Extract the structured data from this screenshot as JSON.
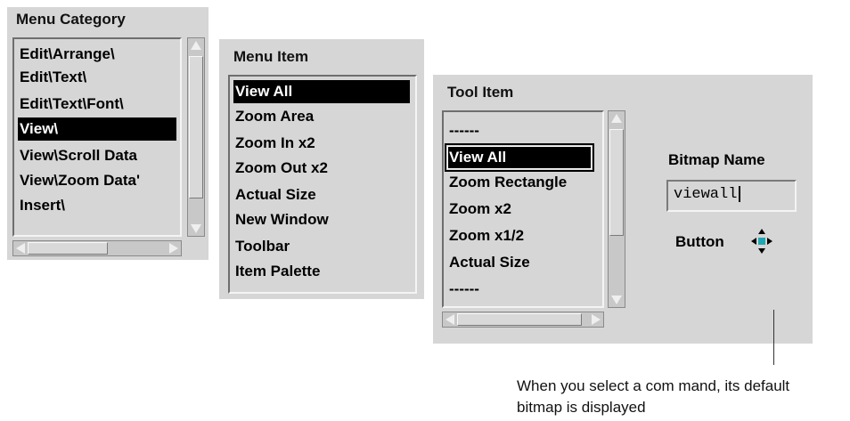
{
  "menu_category": {
    "title": "Menu Category",
    "items": [
      "Edit\\Arrange\\",
      "Edit\\Text\\",
      "Edit\\Text\\Font\\",
      "View\\",
      "View\\Scroll Data",
      "View\\Zoom Data'",
      "Insert\\"
    ],
    "selected_index": 3
  },
  "menu_item": {
    "title": "Menu Item",
    "items": [
      "View All",
      "Zoom Area",
      "Zoom In x2",
      "Zoom Out x2",
      "Actual Size",
      "New Window",
      "Toolbar",
      "Item Palette"
    ],
    "selected_index": 0
  },
  "tool_item": {
    "title": "Tool Item",
    "items": [
      "------",
      "View All",
      "Zoom Rectangle",
      "Zoom x2",
      "Zoom x1/2",
      "Actual Size",
      "------"
    ],
    "selected_index": 1,
    "bitmap_name_label": "Bitmap Name",
    "bitmap_name_value": "viewall",
    "button_label": "Button",
    "button_icon": "four-way-arrows-icon"
  },
  "annotation": {
    "line1": "When you select a com mand, its default",
    "line2": "bitmap is displayed"
  }
}
